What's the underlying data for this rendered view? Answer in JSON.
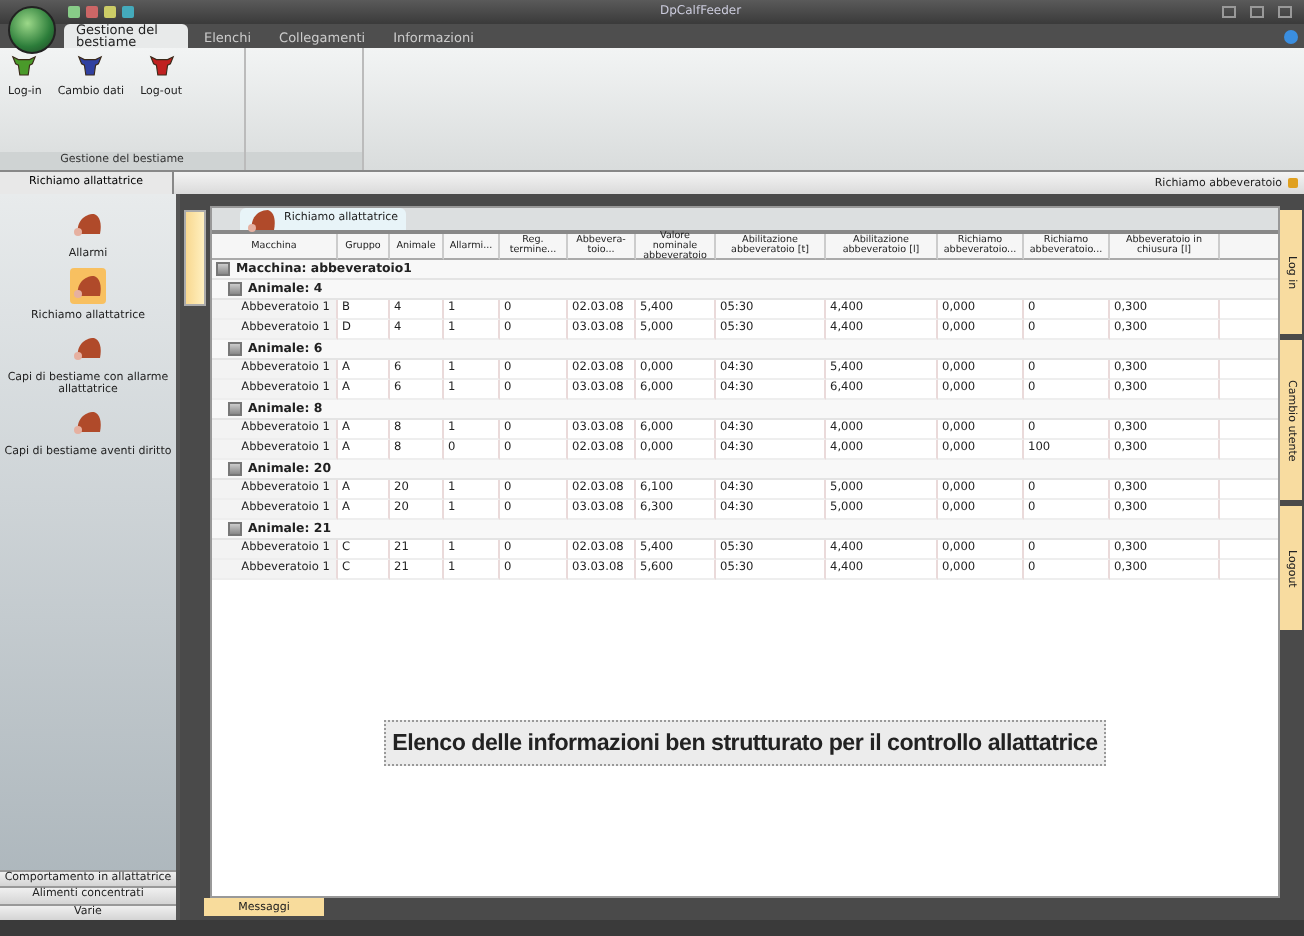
{
  "window": {
    "title": "DpCalfFeeder"
  },
  "ribbon": {
    "tabs": [
      {
        "label": "Gestione del bestiame",
        "selected": true
      },
      {
        "label": "Elenchi",
        "selected": false
      },
      {
        "label": "Collegamenti",
        "selected": false
      },
      {
        "label": "Informazioni",
        "selected": false
      }
    ],
    "buttons": [
      {
        "label": "Log-in",
        "color": "#4a9a2a"
      },
      {
        "label": "Cambio dati",
        "color": "#3040a0"
      },
      {
        "label": "Log-out",
        "color": "#c02020"
      }
    ],
    "group_label": "Gestione del bestiame"
  },
  "breadcrumb": "Richiamo abbeveratoio",
  "sidebar": {
    "header": "Richiamo allattatrice",
    "items": [
      {
        "label": "Allarmi",
        "selected": false
      },
      {
        "label": "Richiamo allattatrice",
        "selected": true
      },
      {
        "label": "Capi di bestiame con allarme allattatrice",
        "selected": false
      },
      {
        "label": "Capi di bestiame aventi diritto",
        "selected": false
      }
    ],
    "sections": [
      "Comportamento in allattatrice",
      "Alimenti concentrati",
      "Varie"
    ]
  },
  "document_tab": {
    "label": "Richiamo allattatrice"
  },
  "table": {
    "columns": [
      "Macchina",
      "Gruppo",
      "Animale",
      "Allarmi...",
      "Reg. termine...",
      "Abbevera-toio...",
      "Valore nominale abbeveratoio",
      "Abilitazione abbeveratoio [t]",
      "Abilitazione abbeveratoio [l]",
      "Richiamo abbeveratoio...",
      "Richiamo abbeveratoio...",
      "Abbeveratoio in chiusura [l]"
    ],
    "machine": "Macchina: abbeveratoio1",
    "groups": [
      {
        "label": "Animale: 4",
        "rows": [
          [
            "Abbeveratoio 1",
            "B",
            "4",
            "1",
            "0",
            "02.03.08",
            "5,400",
            "05:30",
            "4,400",
            "0,000",
            "0",
            "0,300"
          ],
          [
            "Abbeveratoio 1",
            "D",
            "4",
            "1",
            "0",
            "03.03.08",
            "5,000",
            "05:30",
            "4,400",
            "0,000",
            "0",
            "0,300"
          ]
        ]
      },
      {
        "label": "Animale: 6",
        "rows": [
          [
            "Abbeveratoio 1",
            "A",
            "6",
            "1",
            "0",
            "02.03.08",
            "0,000",
            "04:30",
            "5,400",
            "0,000",
            "0",
            "0,300"
          ],
          [
            "Abbeveratoio 1",
            "A",
            "6",
            "1",
            "0",
            "03.03.08",
            "6,000",
            "04:30",
            "6,400",
            "0,000",
            "0",
            "0,300"
          ]
        ]
      },
      {
        "label": "Animale: 8",
        "rows": [
          [
            "Abbeveratoio 1",
            "A",
            "8",
            "1",
            "0",
            "03.03.08",
            "6,000",
            "04:30",
            "4,000",
            "0,000",
            "0",
            "0,300"
          ],
          [
            "Abbeveratoio 1",
            "A",
            "8",
            "0",
            "0",
            "02.03.08",
            "0,000",
            "04:30",
            "4,000",
            "0,000",
            "100",
            "0,300"
          ]
        ]
      },
      {
        "label": "Animale: 20",
        "rows": [
          [
            "Abbeveratoio 1",
            "A",
            "20",
            "1",
            "0",
            "02.03.08",
            "6,100",
            "04:30",
            "5,000",
            "0,000",
            "0",
            "0,300"
          ],
          [
            "Abbeveratoio 1",
            "A",
            "20",
            "1",
            "0",
            "03.03.08",
            "6,300",
            "04:30",
            "5,000",
            "0,000",
            "0",
            "0,300"
          ]
        ]
      },
      {
        "label": "Animale: 21",
        "rows": [
          [
            "Abbeveratoio 1",
            "C",
            "21",
            "1",
            "0",
            "02.03.08",
            "5,400",
            "05:30",
            "4,400",
            "0,000",
            "0",
            "0,300"
          ],
          [
            "Abbeveratoio 1",
            "C",
            "21",
            "1",
            "0",
            "03.03.08",
            "5,600",
            "05:30",
            "4,400",
            "0,000",
            "0",
            "0,300"
          ]
        ]
      }
    ]
  },
  "caption": "Elenco delle informazioni ben strutturato per il controllo allattatrice",
  "side_tabs": [
    "Log in",
    "Cambio utente",
    "Logout"
  ],
  "bottom_tab": "Messaggi"
}
